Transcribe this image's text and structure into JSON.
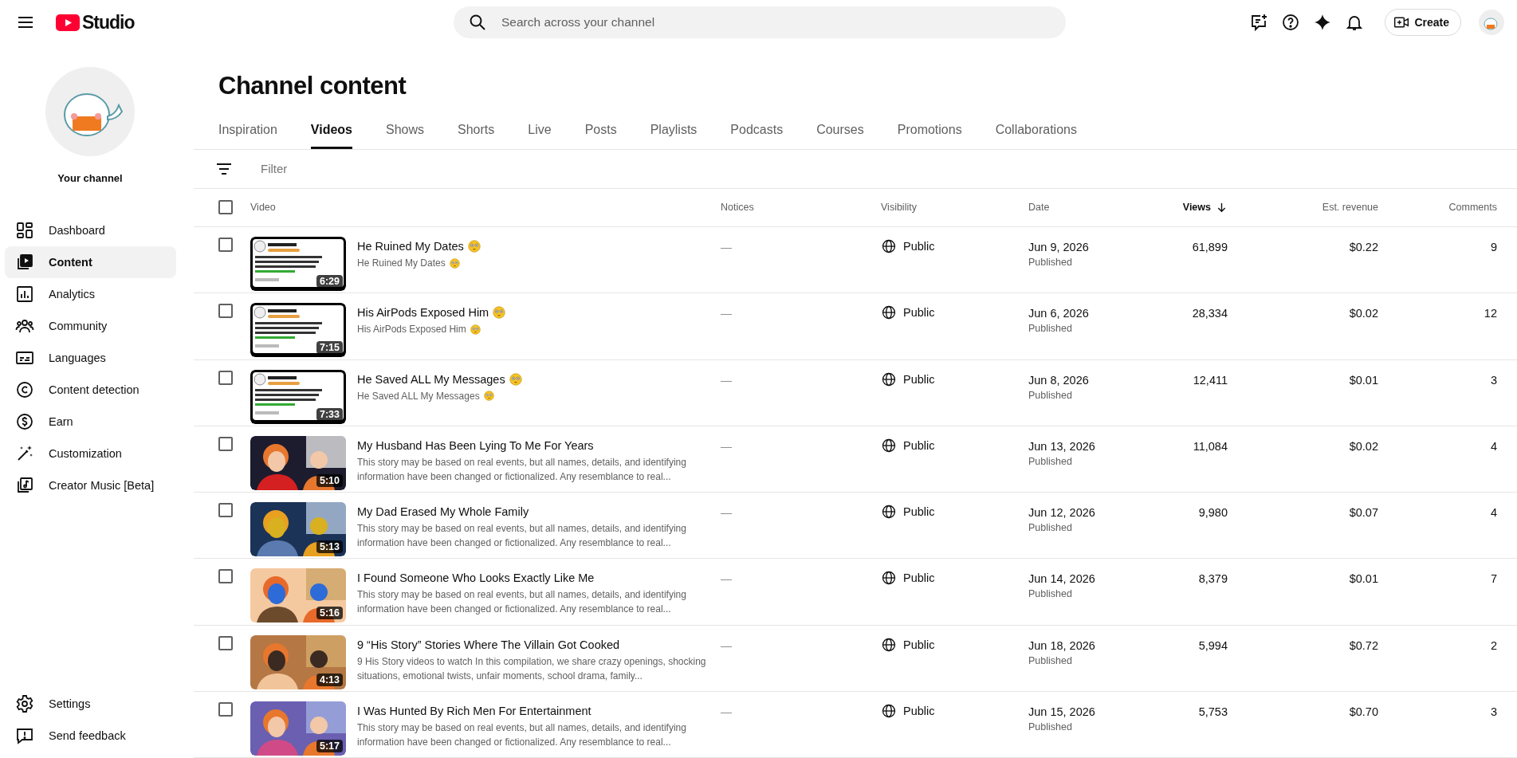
{
  "header": {
    "logo_text": "Studio",
    "search": {
      "placeholder": "Search across your channel"
    },
    "create_label": "Create"
  },
  "channel": {
    "label": "Your channel"
  },
  "nav": [
    {
      "label": "Dashboard",
      "selected": false
    },
    {
      "label": "Content",
      "selected": true
    },
    {
      "label": "Analytics",
      "selected": false
    },
    {
      "label": "Community",
      "selected": false
    },
    {
      "label": "Languages",
      "selected": false
    },
    {
      "label": "Content detection",
      "selected": false
    },
    {
      "label": "Earn",
      "selected": false
    },
    {
      "label": "Customization",
      "selected": false
    },
    {
      "label": "Creator Music [Beta]",
      "selected": false
    }
  ],
  "nav_bottom": [
    {
      "label": "Settings"
    },
    {
      "label": "Send feedback"
    }
  ],
  "page_title": "Channel content",
  "tabs": [
    {
      "label": "Inspiration",
      "selected": false
    },
    {
      "label": "Videos",
      "selected": true
    },
    {
      "label": "Shows",
      "selected": false
    },
    {
      "label": "Shorts",
      "selected": false
    },
    {
      "label": "Live",
      "selected": false
    },
    {
      "label": "Posts",
      "selected": false
    },
    {
      "label": "Playlists",
      "selected": false
    },
    {
      "label": "Podcasts",
      "selected": false
    },
    {
      "label": "Courses",
      "selected": false
    },
    {
      "label": "Promotions",
      "selected": false
    },
    {
      "label": "Collaborations",
      "selected": false
    }
  ],
  "filter": {
    "placeholder": "Filter"
  },
  "table": {
    "select_all_checked": false,
    "columns": [
      {
        "label": "Video",
        "sorted": false
      },
      {
        "label": "Notices",
        "sorted": false
      },
      {
        "label": "Visibility",
        "sorted": false
      },
      {
        "label": "Date",
        "sorted": false
      },
      {
        "label": "Views",
        "sorted": true
      },
      {
        "label": "Est. revenue",
        "sorted": false
      },
      {
        "label": "Comments",
        "sorted": false
      }
    ],
    "rows": [
      {
        "checked": false,
        "thumbnail": {
          "kind": "picture",
          "duration": "6:29"
        },
        "title": "He Ruined My Dates",
        "title_emoji": true,
        "description": "He Ruined My Dates",
        "description_emoji": true,
        "notices": "—",
        "visibility": "Public",
        "date": "Jun 9, 2026",
        "status": "Published",
        "views": "61,899",
        "revenue": "$0.22",
        "comments": "9"
      },
      {
        "checked": false,
        "thumbnail": {
          "kind": "picture",
          "duration": "7:15"
        },
        "title": "His AirPods Exposed Him",
        "title_emoji": true,
        "description": "His AirPods Exposed Him",
        "description_emoji": true,
        "notices": "—",
        "visibility": "Public",
        "date": "Jun 6, 2026",
        "status": "Published",
        "views": "28,334",
        "revenue": "$0.02",
        "comments": "12"
      },
      {
        "checked": false,
        "thumbnail": {
          "kind": "picture",
          "duration": "7:33"
        },
        "title": "He Saved ALL My Messages",
        "title_emoji": true,
        "description": "He Saved ALL My Messages",
        "description_emoji": true,
        "notices": "—",
        "visibility": "Public",
        "date": "Jun 8, 2026",
        "status": "Published",
        "views": "12,411",
        "revenue": "$0.01",
        "comments": "3"
      },
      {
        "checked": false,
        "thumbnail": {
          "kind": "picture",
          "duration": "5:10"
        },
        "title": "My Husband Has Been Lying To Me For Years",
        "title_emoji": false,
        "description": "This story may be based on real events, but all names, details, and identifying information have been changed or fictionalized. Any resemblance to real...",
        "description_emoji": false,
        "notices": "—",
        "visibility": "Public",
        "date": "Jun 13, 2026",
        "status": "Published",
        "views": "11,084",
        "revenue": "$0.02",
        "comments": "4"
      },
      {
        "checked": false,
        "thumbnail": {
          "kind": "picture",
          "duration": "5:13"
        },
        "title": "My Dad Erased My Whole Family",
        "title_emoji": false,
        "description": "This story may be based on real events, but all names, details, and identifying information have been changed or fictionalized. Any resemblance to real...",
        "description_emoji": false,
        "notices": "—",
        "visibility": "Public",
        "date": "Jun 12, 2026",
        "status": "Published",
        "views": "9,980",
        "revenue": "$0.07",
        "comments": "4"
      },
      {
        "checked": false,
        "thumbnail": {
          "kind": "picture",
          "duration": "5:16"
        },
        "title": "I Found Someone Who Looks Exactly Like Me",
        "title_emoji": false,
        "description": "This story may be based on real events, but all names, details, and identifying information have been changed or fictionalized. Any resemblance to real...",
        "description_emoji": false,
        "notices": "—",
        "visibility": "Public",
        "date": "Jun 14, 2026",
        "status": "Published",
        "views": "8,379",
        "revenue": "$0.01",
        "comments": "7"
      },
      {
        "checked": false,
        "thumbnail": {
          "kind": "picture",
          "duration": "4:13"
        },
        "title": "9 “His Story” Stories Where The Villain Got Cooked",
        "title_emoji": false,
        "description": "9 His Story videos to watch In this compilation, we share crazy openings, shocking situations, emotional twists, unfair moments, school drama, family...",
        "description_emoji": false,
        "notices": "—",
        "visibility": "Public",
        "date": "Jun 18, 2026",
        "status": "Published",
        "views": "5,994",
        "revenue": "$0.72",
        "comments": "2"
      },
      {
        "checked": false,
        "thumbnail": {
          "kind": "picture",
          "duration": "5:17"
        },
        "title": "I Was Hunted By Rich Men For Entertainment",
        "title_emoji": false,
        "description": "This story may be based on real events, but all names, details, and identifying information have been changed or fictionalized. Any resemblance to real...",
        "description_emoji": false,
        "notices": "—",
        "visibility": "Public",
        "date": "Jun 15, 2026",
        "status": "Published",
        "views": "5,753",
        "revenue": "$0.70",
        "comments": "3"
      }
    ]
  }
}
